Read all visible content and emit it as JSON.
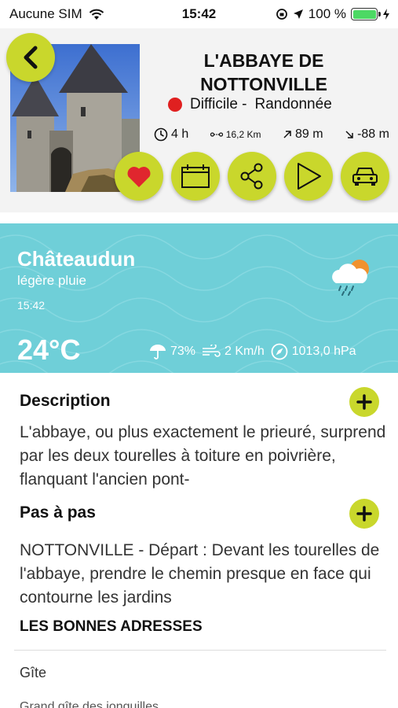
{
  "status_bar": {
    "carrier": "Aucune SIM",
    "time": "15:42",
    "battery": "100 %"
  },
  "header": {
    "title_line1": "L'ABBAYE DE",
    "title_line2": "NOTTONVILLE",
    "difficulty": "Difficile -",
    "activity": "Randonnée",
    "duration": "4 h",
    "distance": "16,2 Km",
    "elevation_up": "89 m",
    "elevation_down": "-88 m"
  },
  "weather": {
    "city": "Châteaudun",
    "condition": "légère pluie",
    "time": "15:42",
    "temperature": "24°C",
    "humidity": "73%",
    "wind": "2 Km/h",
    "pressure": "1013,0 hPa"
  },
  "description": {
    "title": "Description",
    "text": "L'abbaye, ou plus exactement le prieuré, surprend par les deux tourelles à toiture en poivrière, flanquant l'ancien pont-"
  },
  "steps": {
    "title": "Pas à pas",
    "text": "NOTTONVILLE - Départ : Devant les tourelles de l'abbaye, prendre le chemin presque en face qui contourne les jardins"
  },
  "addresses": {
    "title": "LES BONNES ADRESSES",
    "category": "Gîte",
    "item": "Grand gîte des jonquilles"
  },
  "colors": {
    "accent": "#c9d72c",
    "weather_bg": "#6fcfd8",
    "difficulty_dot": "#e02020"
  }
}
